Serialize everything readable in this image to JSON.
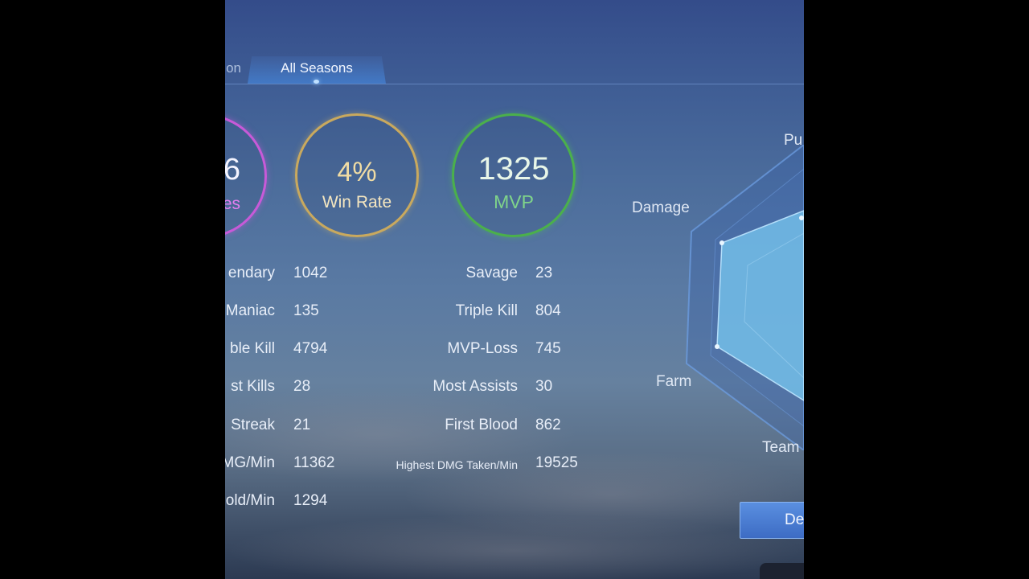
{
  "tabs": [
    {
      "label": "on"
    },
    {
      "label": "All Seasons"
    }
  ],
  "summary": {
    "matches": {
      "value": "6",
      "label": "es"
    },
    "win_rate": {
      "value": "4%",
      "label": "Win Rate"
    },
    "mvp": {
      "value": "1325",
      "label": "MVP"
    }
  },
  "stats_left": [
    {
      "label": "endary",
      "value": "1042"
    },
    {
      "label": "Maniac",
      "value": "135"
    },
    {
      "label": "ble Kill",
      "value": "4794"
    },
    {
      "label": "st Kills",
      "value": "28"
    },
    {
      "label": "Streak",
      "value": "21"
    },
    {
      "label": "MG/Min",
      "value": "11362"
    },
    {
      "label": "old/Min",
      "value": "1294"
    }
  ],
  "stats_right": [
    {
      "label": "Savage",
      "value": "23"
    },
    {
      "label": "Triple Kill",
      "value": "804"
    },
    {
      "label": "MVP-Loss",
      "value": "745"
    },
    {
      "label": "Most Assists",
      "value": "30"
    },
    {
      "label": "First Blood",
      "value": "862"
    },
    {
      "label": "Highest DMG Taken/Min",
      "value": "19525"
    }
  ],
  "radar": {
    "labels": {
      "push": "Pu",
      "damage": "Damage",
      "farm": "Farm",
      "teamfight": "Team"
    }
  },
  "detail_button": {
    "label": "De"
  },
  "colors": {
    "matches_ring": "#c85ad8",
    "winrate_ring": "#c9a95e",
    "mvp_ring": "#4bb04b",
    "tab_active": "#4a8ae0"
  }
}
